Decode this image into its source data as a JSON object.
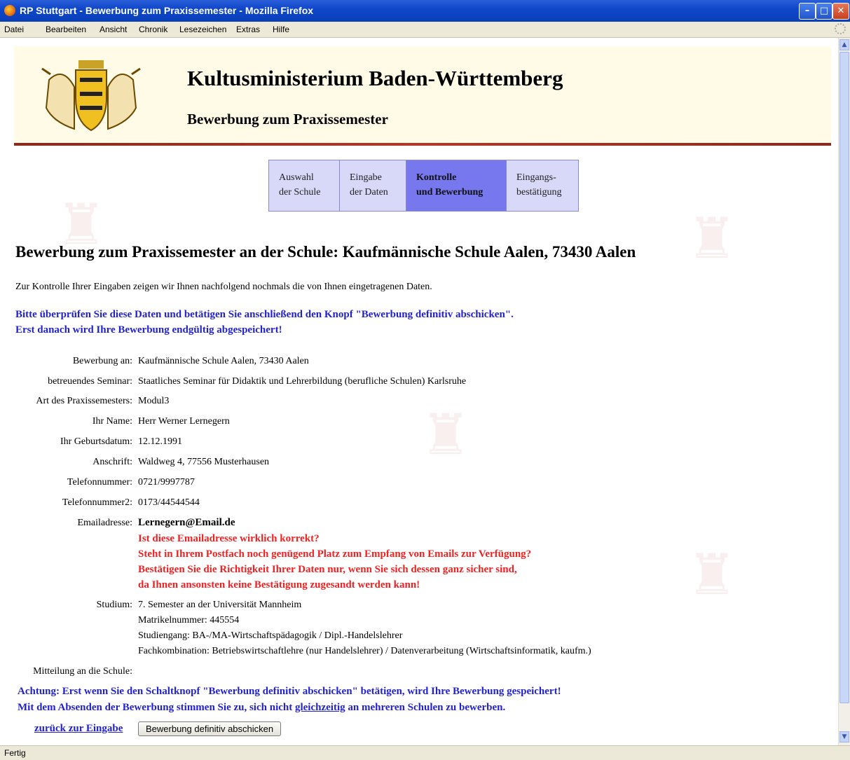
{
  "window": {
    "title": "RP Stuttgart - Bewerbung zum Praxissemester - Mozilla Firefox"
  },
  "menu": [
    "Datei",
    "Bearbeiten",
    "Ansicht",
    "Chronik",
    "Lesezeichen",
    "Extras",
    "Hilfe"
  ],
  "header": {
    "title": "Kultusministerium Baden-Württemberg",
    "subtitle": "Bewerbung zum Praxissemester"
  },
  "steps": [
    {
      "label": "Auswahl\nder Schule",
      "active": false
    },
    {
      "label": "Eingabe\nder Daten",
      "active": false
    },
    {
      "label": "Kontrolle\nund Bewerbung",
      "active": true
    },
    {
      "label": "Eingangs-\nbestätigung",
      "active": false
    }
  ],
  "main": {
    "heading": "Bewerbung zum Praxissemester an der Schule: Kaufmännische Schule Aalen, 73430 Aalen",
    "intro": "Zur Kontrolle Ihrer Eingaben zeigen wir Ihnen nachfolgend nochmals die von Ihnen eingetragenen Daten.",
    "check_line1": "Bitte überprüfen Sie diese Daten und betätigen Sie anschließend den Knopf \"Bewerbung definitiv abschicken\".",
    "check_line2": "Erst danach wird Ihre Bewerbung endgültig abgespeichert!"
  },
  "fields": {
    "bewerbung_an": {
      "label": "Bewerbung an:",
      "value": "Kaufmännische Schule Aalen, 73430 Aalen"
    },
    "seminar": {
      "label": "betreuendes Seminar:",
      "value": "Staatliches Seminar für Didaktik und Lehrerbildung (berufliche Schulen) Karlsruhe"
    },
    "art": {
      "label": "Art des Praxissemesters:",
      "value": "Modul3"
    },
    "name": {
      "label": "Ihr Name:",
      "value": "Herr Werner Lernegern"
    },
    "geburtsdatum": {
      "label": "Ihr Geburtsdatum:",
      "value": "12.12.1991"
    },
    "anschrift": {
      "label": "Anschrift:",
      "value": "Waldweg 4, 77556 Musterhausen"
    },
    "telefon": {
      "label": "Telefonnummer:",
      "value": "0721/9997787"
    },
    "telefon2": {
      "label": "Telefonnummer2:",
      "value": "0173/44544544"
    },
    "email": {
      "label": "Emailadresse:",
      "value": "Lernegern@Email.de"
    },
    "studium": {
      "label": "Studium:",
      "value": "7. Semester an der Universität Mannheim"
    },
    "mitteilung": {
      "label": "Mitteilung an die Schule:",
      "value": ""
    }
  },
  "email_warning": [
    "Ist diese Emailadresse wirklich korrekt?",
    "Steht in Ihrem Postfach noch genügend Platz zum Empfang von Emails zur Verfügung?",
    "Bestätigen Sie die Richtigkeit Ihrer Daten nur, wenn Sie sich dessen ganz sicher sind,",
    "da Ihnen ansonsten keine Bestätigung zugesandt werden kann!"
  ],
  "studium_details": [
    "Matrikelnummer: 445554",
    "Studiengang: BA-/MA-Wirtschaftspädagogik / Dipl.-Handelslehrer",
    "Fachkombination: Betriebswirtschaftlehre (nur Handelslehrer) / Datenverarbeitung (Wirtschaftsinformatik, kaufm.)"
  ],
  "footer": {
    "achtung": "Achtung: Erst wenn Sie den Schaltknopf \"Bewerbung definitiv abschicken\" betätigen, wird Ihre Bewerbung gespeichert!",
    "consent_pre": "Mit dem Absenden der Bewerbung stimmen Sie zu, sich nicht ",
    "consent_link": "gleichzeitig",
    "consent_post": " an mehreren Schulen zu bewerben.",
    "back_link": "zurück zur Eingabe",
    "submit_label": "Bewerbung definitiv abschicken"
  },
  "status": "Fertig",
  "colors": {
    "accent_blue": "#2222cc",
    "warning_red": "#ee2222",
    "header_bg": "#fffbe6",
    "active_step": "#7777ee"
  }
}
